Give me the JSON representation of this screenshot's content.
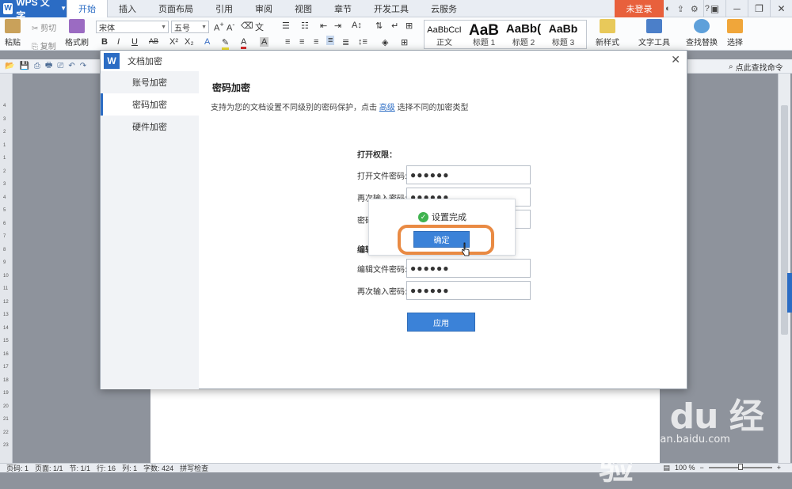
{
  "app": {
    "logo_label": "WPS 文字"
  },
  "menu": {
    "tabs": [
      "开始",
      "插入",
      "页面布局",
      "引用",
      "审阅",
      "视图",
      "章节",
      "开发工具",
      "云服务"
    ],
    "login": "未登录"
  },
  "ribbon": {
    "paste": "粘贴",
    "cut": "剪切",
    "copy": "复制",
    "format_painter": "格式刷",
    "font_name": "宋体",
    "font_size": "五号",
    "styles": [
      {
        "sample": "AaBbCcI",
        "name": "正文"
      },
      {
        "sample": "AaB",
        "name": "标题 1"
      },
      {
        "sample": "AaBb(",
        "name": "标题 2"
      },
      {
        "sample": "AaBb",
        "name": "标题 3"
      }
    ],
    "new_style": "新样式",
    "text_tools": "文字工具",
    "find_replace": "查找替换",
    "select": "选择"
  },
  "quick_access": {
    "find_command": "点此查找命令"
  },
  "dialog": {
    "title": "文档加密",
    "sidebar": [
      "账号加密",
      "密码加密",
      "硬件加密"
    ],
    "heading": "密码加密",
    "description_pre": "支持为您的文档设置不同级别的密码保护，点击",
    "description_link": "高级",
    "description_post": "选择不同的加密类型",
    "open_permission_label": "打开权限：",
    "open_password_label": "打开文件密码:",
    "open_password_value": "●●●●●●",
    "reenter_label": "再次输入密码:",
    "reenter_value": "●●●●●●",
    "hint_label_partial": "密码",
    "edit_permission_partial": "编辑",
    "edit_password_label": "编辑文件密码:",
    "edit_password_value": "●●●●●●",
    "edit_reenter_label": "再次输入密码:",
    "edit_reenter_value": "●●●●●●",
    "apply": "应用",
    "popup": {
      "message": "设置完成",
      "confirm": "确定"
    }
  },
  "statusbar": {
    "page_code": "页码: 1",
    "page": "页面: 1/1",
    "section": "节: 1/1",
    "row": "行: 16",
    "col": "列: 1",
    "word_count": "字数: 424",
    "spell_check": "拼写检查",
    "zoom": "100 %"
  },
  "watermark": {
    "logo": "Bai du 经验",
    "url": "jingyan.baidu.com"
  },
  "ruler_numbers": [
    "4",
    "3",
    "2",
    "1",
    "1",
    "2",
    "3",
    "4",
    "5",
    "6",
    "7",
    "8",
    "9",
    "10",
    "11",
    "12",
    "13",
    "14",
    "15",
    "16",
    "17",
    "18",
    "19",
    "20",
    "21",
    "22",
    "23"
  ]
}
